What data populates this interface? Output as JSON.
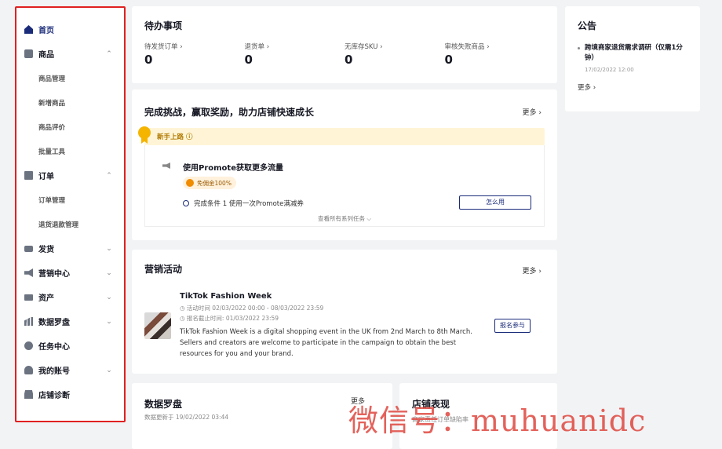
{
  "sidebar": {
    "items": [
      {
        "label": "首页",
        "icon": "home-icon",
        "active": true
      },
      {
        "label": "商品",
        "icon": "product-icon",
        "chevron": "⌃"
      },
      {
        "label": "商品管理",
        "sub": true
      },
      {
        "label": "新增商品",
        "sub": true
      },
      {
        "label": "商品评价",
        "sub": true
      },
      {
        "label": "批量工具",
        "sub": true
      },
      {
        "label": "订单",
        "icon": "order-icon",
        "chevron": "⌃"
      },
      {
        "label": "订单管理",
        "sub": true
      },
      {
        "label": "退货退款管理",
        "sub": true
      },
      {
        "label": "发货",
        "icon": "truck-icon",
        "chevron": "⌄"
      },
      {
        "label": "营销中心",
        "icon": "megaphone-icon",
        "chevron": "⌄"
      },
      {
        "label": "资产",
        "icon": "wallet-icon",
        "chevron": "⌄"
      },
      {
        "label": "数据罗盘",
        "icon": "chart-icon",
        "chevron": "⌄"
      },
      {
        "label": "任务中心",
        "icon": "medal-icon"
      },
      {
        "label": "我的账号",
        "icon": "user-icon",
        "chevron": "⌄"
      },
      {
        "label": "店铺诊断",
        "icon": "shop-icon"
      }
    ]
  },
  "todo": {
    "title": "待办事项",
    "items": [
      {
        "label": "待发货订单 ›",
        "value": "0"
      },
      {
        "label": "退货单 ›",
        "value": "0"
      },
      {
        "label": "无库存SKU ›",
        "value": "0"
      },
      {
        "label": "审核失败商品 ›",
        "value": "0"
      }
    ]
  },
  "notice": {
    "title": "公告",
    "item_text": "跨境商家退货需求调研（仅需1分钟）",
    "item_date": "17/02/2022 12:00",
    "more": "更多 ›"
  },
  "challenge": {
    "title": "完成挑战，赢取奖励，助力店铺快速成长",
    "more": "更多 ›",
    "banner": "新手上路 ⓘ",
    "task_title": "使用Promote获取更多流量",
    "task_badge": "免佣金100%",
    "task_condition": "完成条件 1  使用一次Promote满减券",
    "how_button": "怎么用",
    "view_all": "查看所有系列任务 ⌵"
  },
  "marketing": {
    "title": "营销活动",
    "more": "更多 ›",
    "event_name": "TikTok Fashion Week",
    "event_time": "◷ 活动时间  02/03/2022 00:00 - 08/03/2022 23:59",
    "event_deadline": "◷ 报名截止时间: 01/03/2022 23:59",
    "event_desc": "TikTok Fashion Week is a digital shopping event in the UK from 2nd March to 8th March. Sellers and creators are welcome to participate in the campaign to obtain the best resources for you and your brand.",
    "join_button": "报名参与"
  },
  "data_compass": {
    "title": "数据罗盘",
    "updated": "数据更新于 19/02/2022 03:44",
    "more": "更多"
  },
  "shop_perf": {
    "title": "店铺表现",
    "sub": "商家责任订单缺陷率"
  },
  "watermark": "微信号：muhuanidc"
}
